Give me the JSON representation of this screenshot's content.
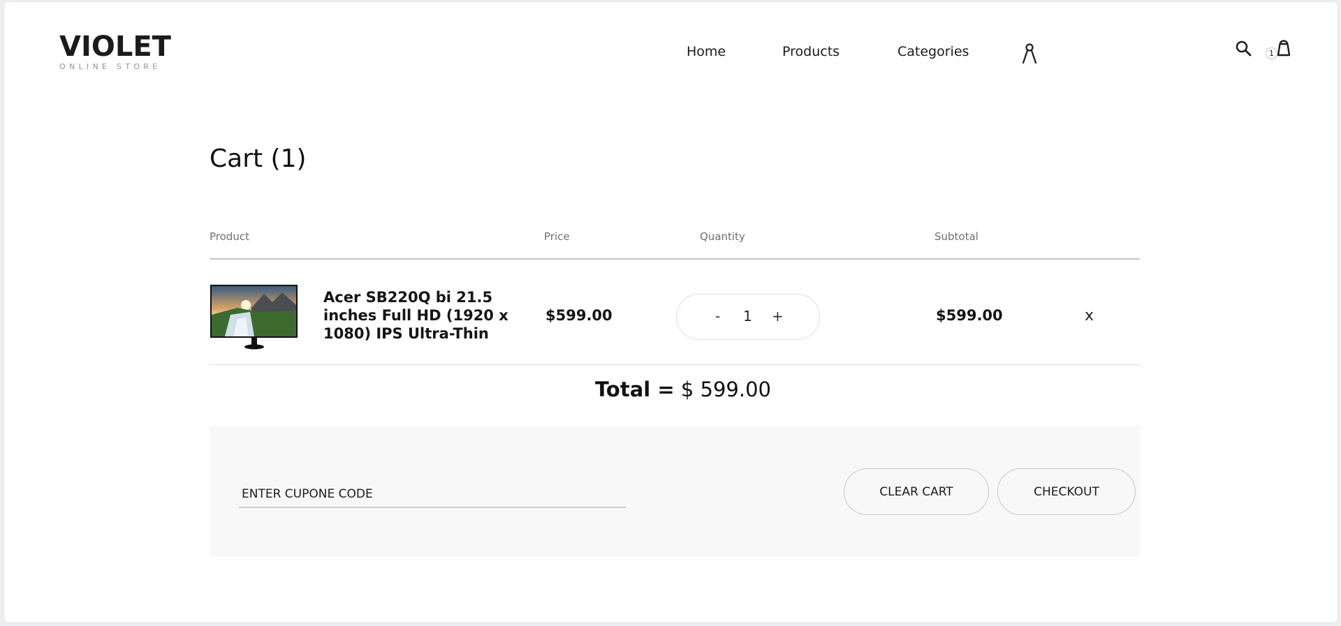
{
  "header": {
    "logo": {
      "main": "VIOLET",
      "sub": "ONLINE STORE"
    },
    "nav": {
      "home": "Home",
      "products": "Products",
      "categories": "Categories"
    },
    "icons": [
      "user-icon",
      "search-icon",
      "shopping-bag-icon"
    ],
    "cart_count": "1"
  },
  "cart": {
    "title": "Cart (1)",
    "columns": {
      "product": "Product",
      "price": "Price",
      "quantity": "Quantity",
      "subtotal": "Subtotal"
    },
    "items": [
      {
        "name": "Acer SB220Q bi 21.5 inches Full HD (1920 x 1080) IPS Ultra-Thin",
        "price": "$599.00",
        "quantity": "1",
        "minus": "-",
        "plus": "+",
        "subtotal": "$599.00",
        "remove": "x"
      }
    ],
    "total_label": "Total =",
    "total_value": "$ 599.00"
  },
  "actions": {
    "coupon_placeholder": "ENTER CUPONE CODE",
    "clear_cart": "CLEAR CART",
    "checkout": "CHECKOUT"
  },
  "colors": {
    "text": "#111111",
    "muted": "#6b7075",
    "logo_sub": "#8d95a0",
    "border": "#c6c9cc",
    "panel_bg": "#f7f8f7"
  }
}
